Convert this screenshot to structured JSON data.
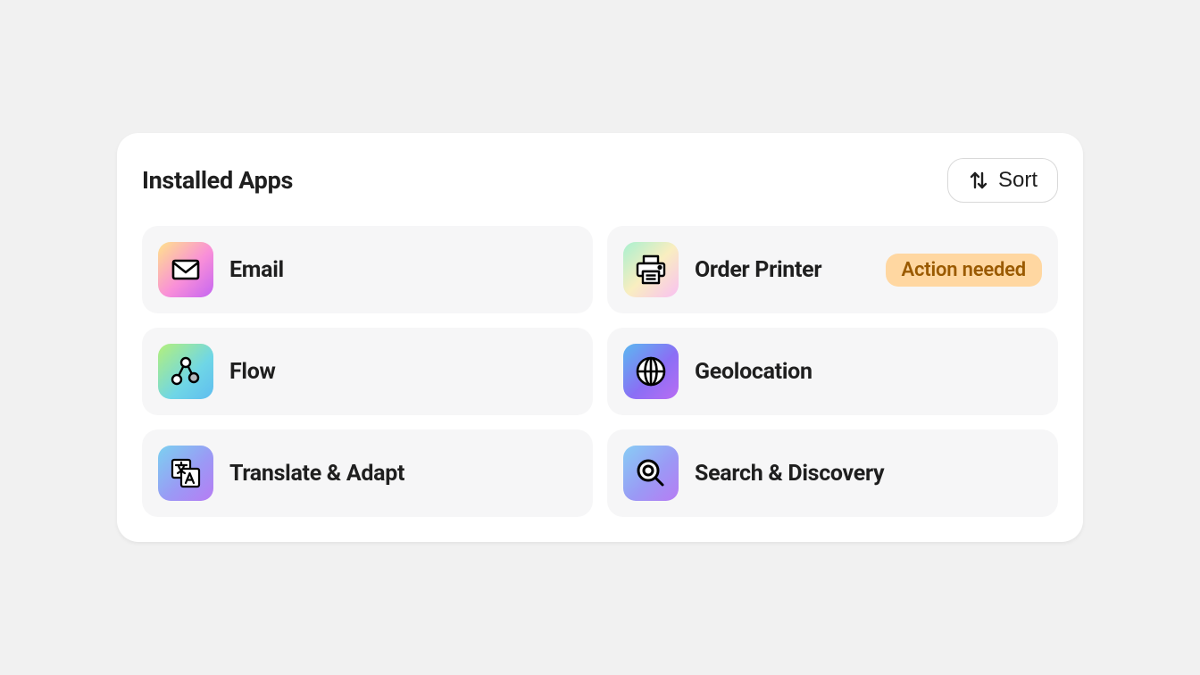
{
  "header": {
    "title": "Installed Apps",
    "sort_label": "Sort"
  },
  "apps": [
    {
      "name": "Email",
      "icon": "email-icon",
      "gradient": "grad-0",
      "badge": null
    },
    {
      "name": "Order Printer",
      "icon": "printer-icon",
      "gradient": "grad-3",
      "badge": "Action needed"
    },
    {
      "name": "Flow",
      "icon": "flow-icon",
      "gradient": "grad-1",
      "badge": null
    },
    {
      "name": "Geolocation",
      "icon": "globe-icon",
      "gradient": "grad-4",
      "badge": null
    },
    {
      "name": "Translate & Adapt",
      "icon": "translate-icon",
      "gradient": "grad-2",
      "badge": null
    },
    {
      "name": "Search & Discovery",
      "icon": "search-icon",
      "gradient": "grad-5",
      "badge": null
    }
  ],
  "colors": {
    "badge_bg": "#ffd7a1",
    "badge_text": "#9a5a00"
  }
}
